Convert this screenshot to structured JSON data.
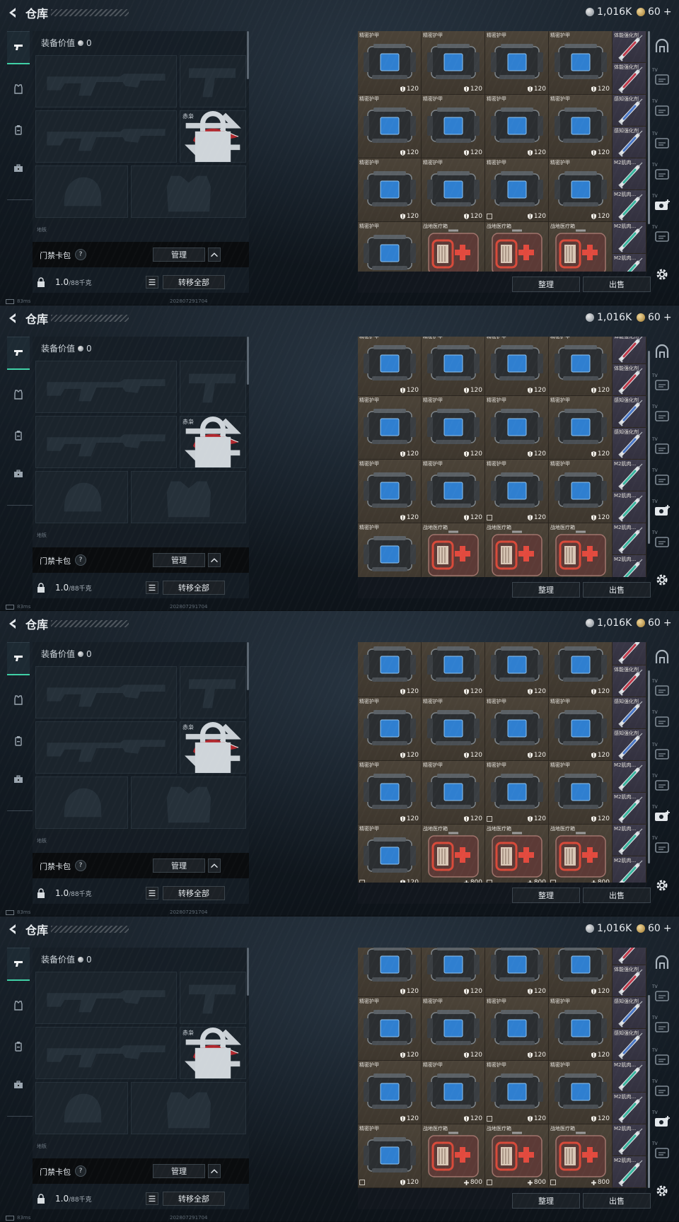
{
  "frames": [
    {
      "inv_scroll_fraction": 0.0
    },
    {
      "inv_scroll_fraction": 0.3
    },
    {
      "inv_scroll_fraction": 0.6
    },
    {
      "inv_scroll_fraction": 1.0
    }
  ],
  "header": {
    "title": "仓库",
    "silver_amount": "1,016K",
    "gold_amount": "60",
    "gold_plus": "+"
  },
  "equipment": {
    "value_label": "装备价值",
    "value": "0",
    "knife_label": "赤枭",
    "dim_label": "地板",
    "bag_label": "门禁卡包",
    "help": "?",
    "manage_label": "管理",
    "weight_value": "1.0",
    "weight_max": "/88千克",
    "transfer_all_label": "转移全部"
  },
  "status": {
    "ping": "83ms",
    "build": "202807291704"
  },
  "inventory": {
    "sort_label": "整理",
    "sell_label": "出售",
    "rows": [
      {
        "name": "精密护甲",
        "type": "armor",
        "val": "120",
        "corner": false
      },
      {
        "name": "精密护甲",
        "type": "armor",
        "val": "120",
        "corner": false
      },
      {
        "name": "精密护甲",
        "type": "armor",
        "val": "120",
        "corner": true
      },
      {
        "name": "精密护甲",
        "type": "armor",
        "val": "120",
        "corner": true
      }
    ],
    "bottom_row": [
      {
        "name": "精密护甲",
        "type": "armor",
        "val": "120",
        "corner": true
      },
      {
        "name": "战地医疗箱",
        "type": "medkit",
        "val": "800",
        "corner": false
      },
      {
        "name": "战地医疗箱",
        "type": "medkit",
        "val": "800",
        "corner": true
      },
      {
        "name": "战地医疗箱",
        "type": "medkit",
        "val": "800",
        "corner": true
      }
    ],
    "syringes": [
      {
        "name": "体能强化剂",
        "color": "#c0394a"
      },
      {
        "name": "体能强化剂",
        "color": "#c0394a"
      },
      {
        "name": "感知强化剂",
        "color": "#4a78c8"
      },
      {
        "name": "感知强化剂",
        "color": "#4a78c8"
      },
      {
        "name": "M2肌肉...",
        "color": "#39b7a0"
      },
      {
        "name": "M2肌肉...",
        "color": "#39b7a0"
      },
      {
        "name": "M2肌肉...",
        "color": "#39b7a0"
      },
      {
        "name": "M2肌肉...",
        "color": "#39b7a0"
      },
      {
        "name": "M2肌肉...",
        "color": "#39b7a0"
      },
      {
        "name": "M2肌肉...",
        "color": "#39b7a0"
      }
    ]
  },
  "rail": {
    "tv_label": "TV"
  },
  "icons": {
    "back": "back-arrow-icon",
    "silver": "silver-coin-icon",
    "gold": "gold-coin-icon",
    "gear": "gear-icon",
    "armor_shield": "shield-icon",
    "plus": "plus-icon"
  }
}
